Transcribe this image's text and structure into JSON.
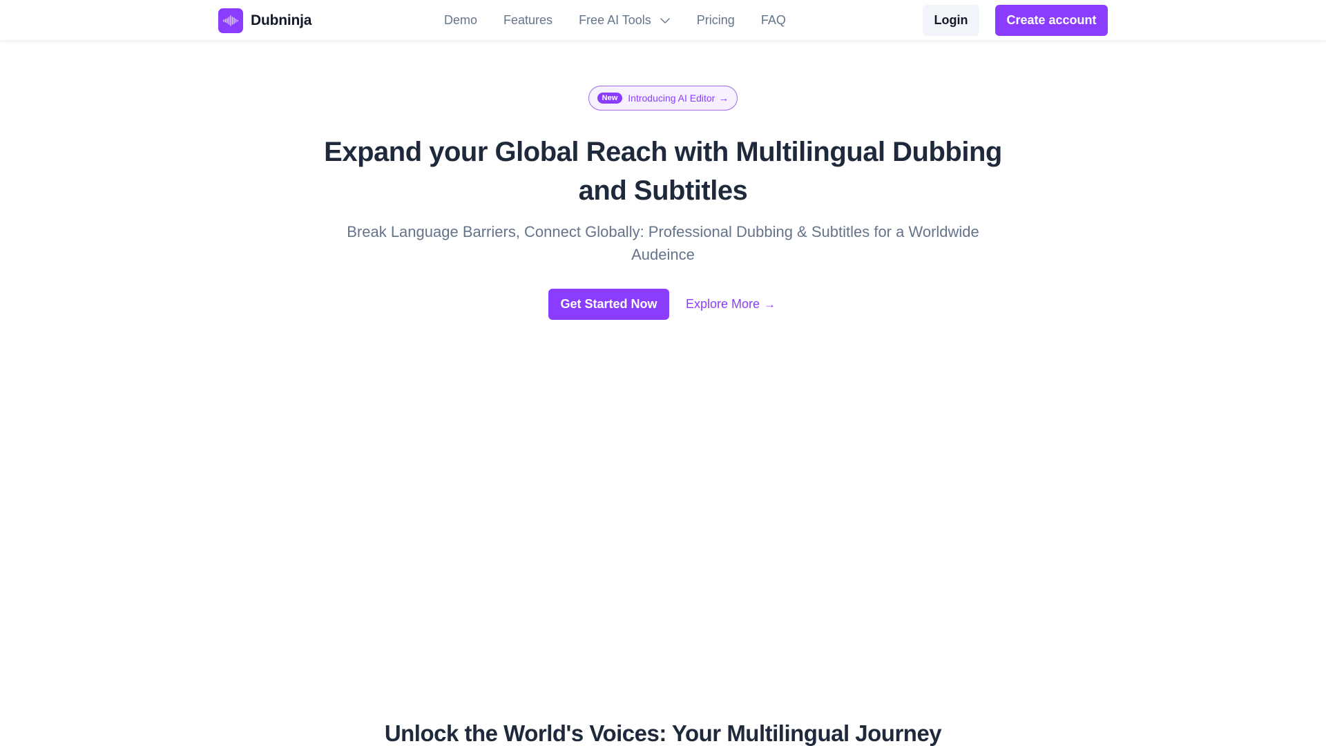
{
  "brand": {
    "name": "Dubninja",
    "logo_icon": "audio-waveform-icon",
    "accent_color": "#8b3dff"
  },
  "nav": {
    "items": [
      {
        "label": "Demo"
      },
      {
        "label": "Features"
      },
      {
        "label": "Free AI Tools",
        "icon": "chevron-down-icon"
      },
      {
        "label": "Pricing"
      },
      {
        "label": "FAQ"
      }
    ]
  },
  "header_actions": {
    "login_label": "Login",
    "create_account_label": "Create account"
  },
  "hero": {
    "badge": {
      "pill": "New",
      "text": "Introducing AI Editor",
      "arrow": "→"
    },
    "headline": "Expand your Global Reach with Multilingual Dubbing and Subtitles",
    "subheadline": "Break Language Barriers, Connect Globally: Professional Dubbing & Subtitles for a Worldwide Audeince",
    "primary_cta": "Get Started Now",
    "secondary_cta": "Explore More",
    "secondary_cta_arrow": "→"
  },
  "next_section": {
    "heading": "Unlock the World's Voices: Your Multilingual Journey"
  }
}
